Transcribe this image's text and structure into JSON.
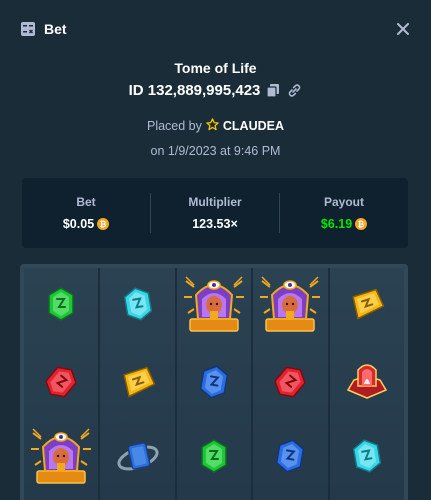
{
  "header": {
    "title": "Bet",
    "icon": "bet-slip-icon",
    "close_icon": "close-icon"
  },
  "bet": {
    "game": "Tome of Life",
    "id_label": "ID 132,889,995,423",
    "placed_prefix": "Placed by",
    "user": "CLAUDEA",
    "date": "on 1/9/2023 at 9:46 PM"
  },
  "stats": {
    "bet_label": "Bet",
    "bet_value": "$0.05",
    "multiplier_label": "Multiplier",
    "multiplier_value": "123.53×",
    "payout_label": "Payout",
    "payout_value": "$6.19"
  },
  "colors": {
    "background": "#1a2c38",
    "panel": "#0f212e",
    "payout_green": "#00e701",
    "muted_text": "#b1bad3",
    "coin": "#f5a623"
  },
  "reels": [
    [
      "green-gem",
      "red-gem",
      "pharaoh"
    ],
    [
      "cyan-gem",
      "yellow-gem",
      "blue-scroll"
    ],
    [
      "pharaoh",
      "blue-gem",
      "green-gem"
    ],
    [
      "pharaoh",
      "red-gem",
      "blue-gem"
    ],
    [
      "yellow-gem",
      "red-tome",
      "cyan-gem"
    ]
  ]
}
